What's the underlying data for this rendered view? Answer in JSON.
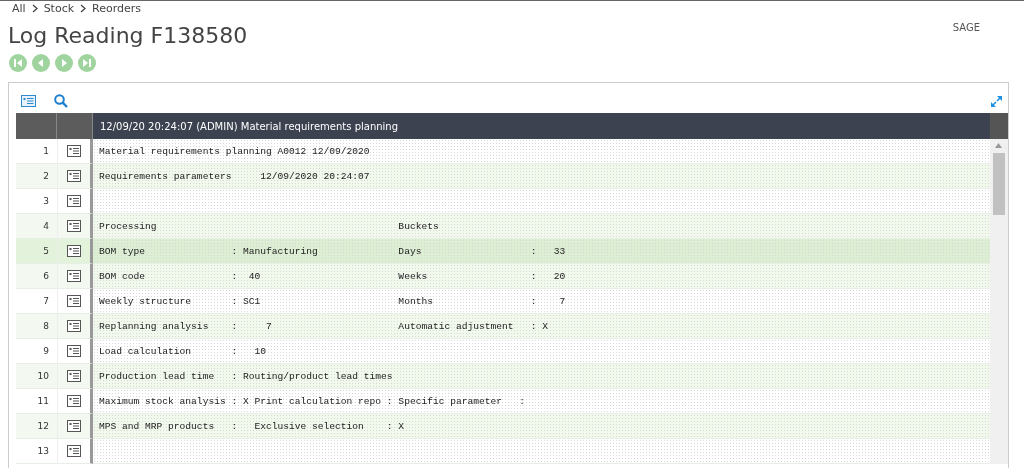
{
  "breadcrumb": [
    "All",
    "Stock",
    "Reorders"
  ],
  "title": "Log Reading F138580",
  "company": "SAGE",
  "grid": {
    "header": "12/09/20 20:24:07 (ADMIN) Material requirements planning",
    "rows": [
      {
        "number": "1",
        "text": "Material requirements planning A0012 12/09/2020",
        "selected": false
      },
      {
        "number": "2",
        "text": "Requirements parameters     12/09/2020 20:24:07",
        "selected": false
      },
      {
        "number": "3",
        "selected": false
      },
      {
        "number": "4",
        "text": "Processing                                          Buckets",
        "selected": false
      },
      {
        "number": "5",
        "text": "BOM type               : Manufacturing              Days                   :   33",
        "selected": true
      },
      {
        "number": "6",
        "text": "BOM code               :  40                        Weeks                  :   20",
        "selected": false
      },
      {
        "number": "7",
        "text": "Weekly structure       : SC1                        Months                 :    7",
        "selected": false
      },
      {
        "number": "8",
        "text": "Replanning analysis    :     7                      Automatic adjustment   : X",
        "selected": false
      },
      {
        "number": "9",
        "text": "Load calculation       :   10",
        "selected": false
      },
      {
        "number": "10",
        "text": "Production lead time   : Routing/product lead times",
        "selected": false
      },
      {
        "number": "11",
        "text": "Maximum stock analysis : X Print calculation repo : Specific parameter   :",
        "selected": false
      },
      {
        "number": "12",
        "text": "MPS and MRP products   :   Exclusive selection    : X",
        "selected": false
      },
      {
        "number": "13",
        "selected": false
      }
    ]
  }
}
